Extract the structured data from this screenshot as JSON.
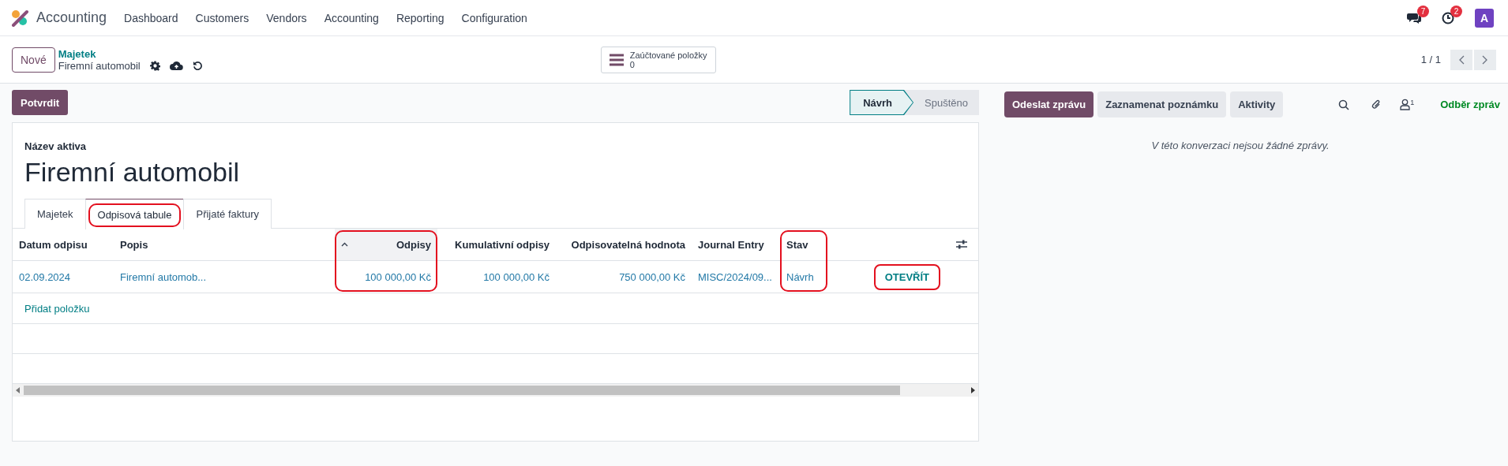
{
  "navbar": {
    "app_name": "Accounting",
    "menu": [
      "Dashboard",
      "Customers",
      "Vendors",
      "Accounting",
      "Reporting",
      "Configuration"
    ],
    "messages_badge": "7",
    "activities_badge": "2",
    "avatar": "A"
  },
  "control_panel": {
    "new_button": "Nové",
    "breadcrumb": "Majetek",
    "record": "Firemní automobil",
    "smart_button": {
      "label": "Zaúčtované položky",
      "value": "0"
    },
    "pager": "1 / 1"
  },
  "confirm_button": "Potvrdit",
  "stages": [
    {
      "label": "Návrh",
      "selected": true
    },
    {
      "label": "Spuštěno",
      "selected": false
    }
  ],
  "form": {
    "name_label": "Název aktiva",
    "title": "Firemní automobil",
    "tabs": [
      {
        "label": "Majetek",
        "selected": false,
        "highlighted": false
      },
      {
        "label": "Odpisová tabule",
        "selected": true,
        "highlighted": true
      },
      {
        "label": "Přijaté faktury",
        "selected": false,
        "highlighted": false
      }
    ],
    "table": {
      "columns": [
        {
          "label": "Datum odpisu",
          "kind": "text",
          "sorted": false,
          "highlighted": false
        },
        {
          "label": "Popis",
          "kind": "text",
          "sorted": false,
          "highlighted": false
        },
        {
          "label": "Odpisy",
          "kind": "number",
          "sorted": true,
          "highlighted": true
        },
        {
          "label": "Kumulativní odpisy",
          "kind": "number",
          "sorted": false,
          "highlighted": false
        },
        {
          "label": "Odpisovatelná hodnota",
          "kind": "number",
          "sorted": false,
          "highlighted": false
        },
        {
          "label": "Journal Entry",
          "kind": "text",
          "sorted": false,
          "highlighted": false
        },
        {
          "label": "Stav",
          "kind": "text",
          "sorted": false,
          "highlighted": true
        }
      ],
      "rows": [
        {
          "cells": [
            "02.09.2024",
            "Firemní automob...",
            "100 000,00 Kč",
            "100 000,00 Kč",
            "750 000,00 Kč",
            "MISC/2024/09...",
            "Návrh"
          ],
          "button": {
            "label": "OTEVŘÍT",
            "highlighted": true
          }
        }
      ],
      "add_line": "Přidat položku"
    }
  },
  "chatter": {
    "buttons": [
      {
        "label": "Odeslat zprávu",
        "kind": "primary"
      },
      {
        "label": "Zaznamenat poznámku",
        "kind": "secondary"
      },
      {
        "label": "Aktivity",
        "kind": "secondary"
      }
    ],
    "followers_count": "1",
    "follow": "Odběr zpráv",
    "empty": "V této konverzaci nejsou žádné zprávy."
  }
}
